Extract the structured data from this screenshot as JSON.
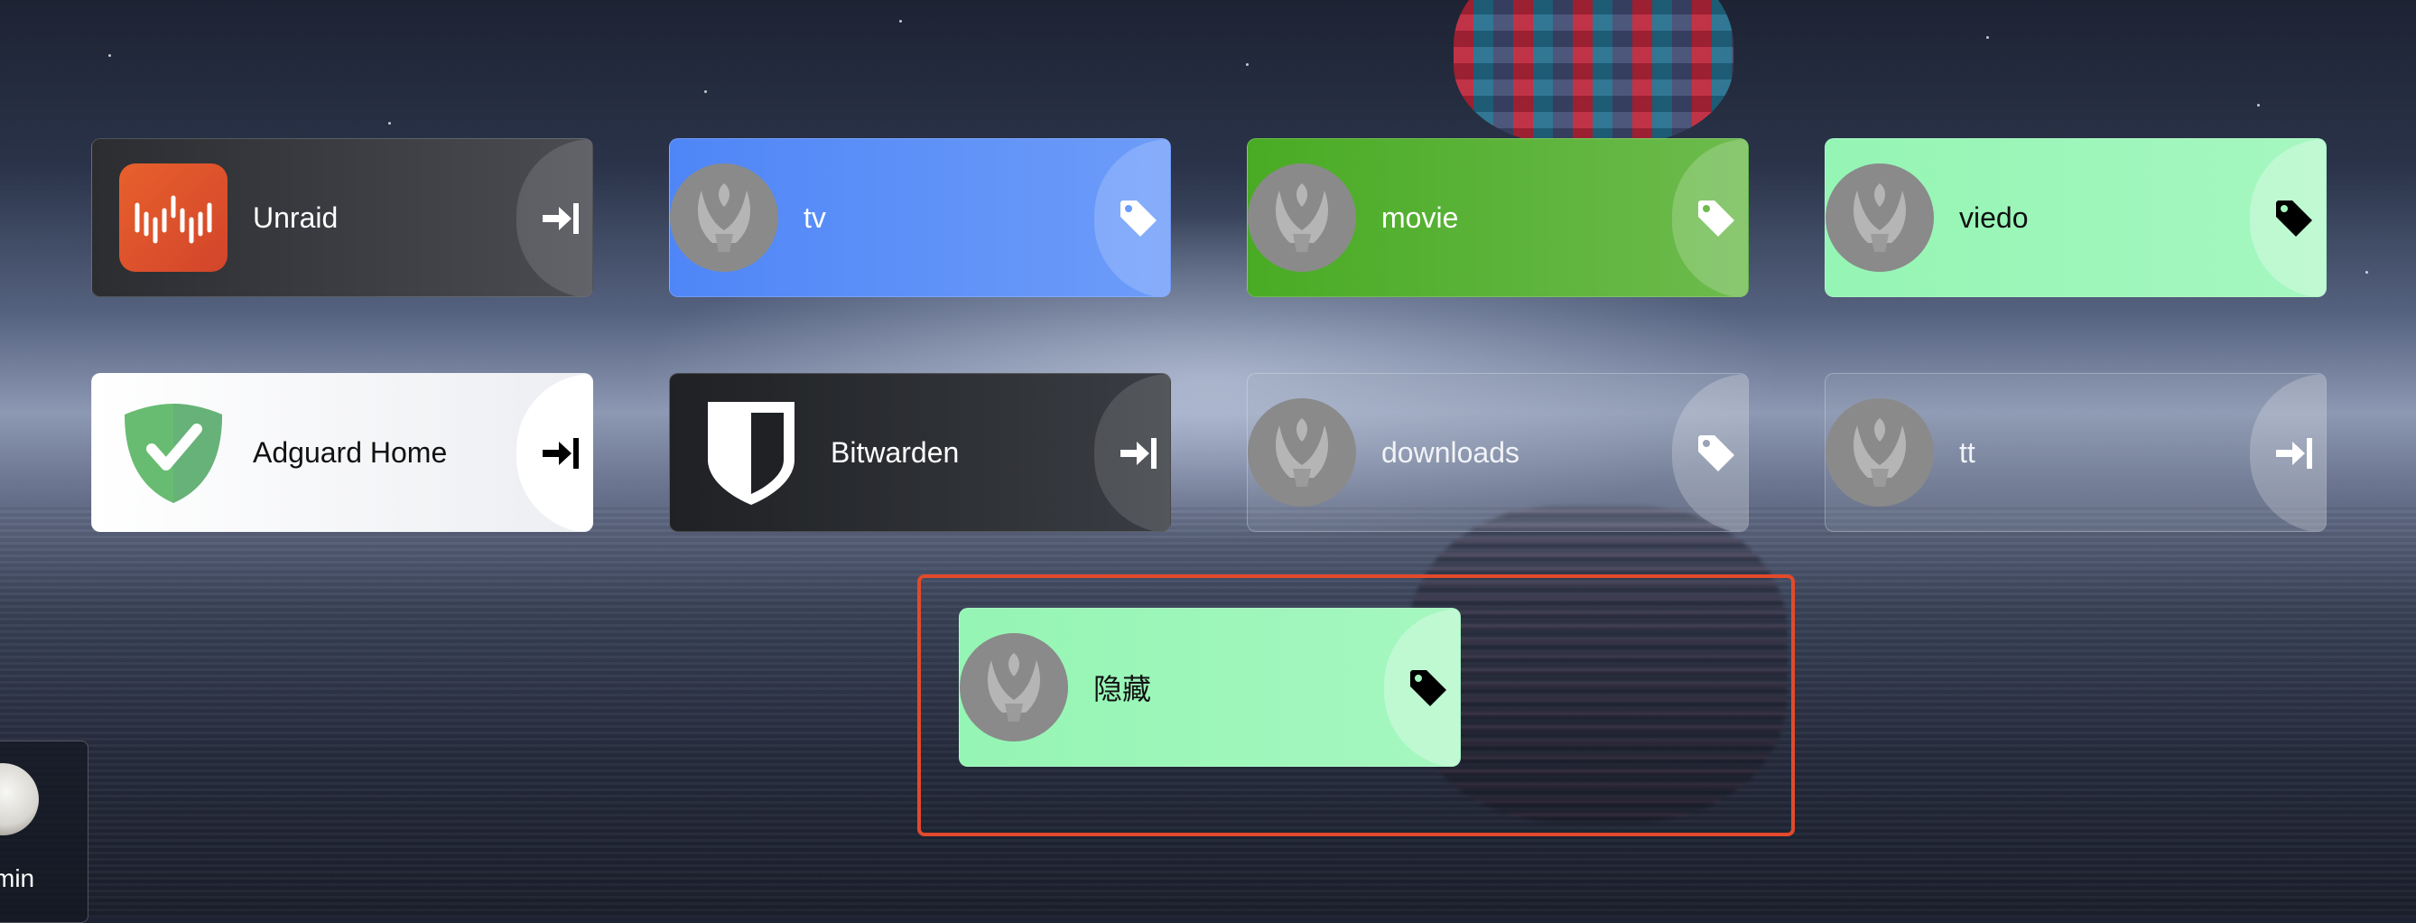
{
  "colors": {
    "highlight_border": "#e24a2b",
    "card_blue": "#4f86f7",
    "card_green": "#49ab24",
    "card_mint": "#95f5b4",
    "card_dark": "#2b2d31"
  },
  "cards": [
    {
      "label": "Unraid",
      "icon": "unraid-logo-icon",
      "action": "enter-icon"
    },
    {
      "label": "tv",
      "icon": "avatar-placeholder-icon",
      "action": "tag-icon"
    },
    {
      "label": "movie",
      "icon": "avatar-placeholder-icon",
      "action": "tag-icon"
    },
    {
      "label": "viedo",
      "icon": "avatar-placeholder-icon",
      "action": "tag-icon"
    },
    {
      "label": "Adguard Home",
      "icon": "adguard-shield-icon",
      "action": "enter-icon"
    },
    {
      "label": "Bitwarden",
      "icon": "bitwarden-shield-icon",
      "action": "enter-icon"
    },
    {
      "label": "downloads",
      "icon": "avatar-placeholder-icon",
      "action": "tag-icon"
    },
    {
      "label": "tt",
      "icon": "avatar-placeholder-icon",
      "action": "enter-icon"
    },
    {
      "label": "隐藏",
      "icon": "avatar-placeholder-icon",
      "action": "tag-icon"
    }
  ],
  "user": {
    "name": "min"
  }
}
